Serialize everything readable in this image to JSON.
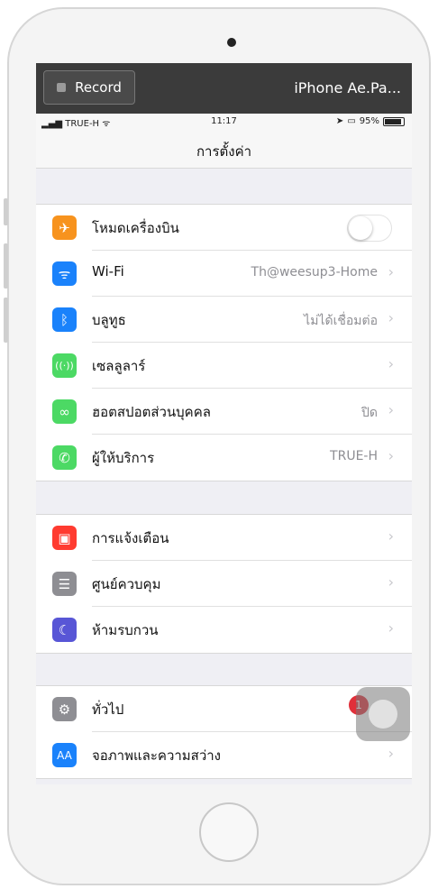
{
  "recorder": {
    "button_label": "Record",
    "device_title": "iPhone Ae.Pa..."
  },
  "status_bar": {
    "carrier": "TRUE-H",
    "time": "11:17",
    "battery": "95%"
  },
  "nav": {
    "title": "การตั้งค่า"
  },
  "colors": {
    "airplane": "#f7931e",
    "wifi": "#1a82fb",
    "bluetooth": "#1a82fb",
    "cellular": "#4cd964",
    "hotspot": "#4cd964",
    "carrier": "#4cd964",
    "notifications": "#ff3b30",
    "control_center": "#8e8e93",
    "dnd": "#5856d6",
    "general": "#8e8e93",
    "display": "#1a82fb",
    "badge": "#e0303a"
  },
  "group1": [
    {
      "label": "โหมดเครื่องบิน",
      "icon": "airplane-icon",
      "toggle": "off"
    },
    {
      "label": "Wi-Fi",
      "icon": "wifi-icon",
      "value": "Th@weesup3-Home"
    },
    {
      "label": "บลูทูธ",
      "icon": "bluetooth-icon",
      "value": "ไม่ได้เชื่อมต่อ"
    },
    {
      "label": "เซลลูลาร์",
      "icon": "cellular-icon",
      "value": ""
    },
    {
      "label": "ฮอตสปอตส่วนบุคคล",
      "icon": "hotspot-icon",
      "value": "ปิด"
    },
    {
      "label": "ผู้ให้บริการ",
      "icon": "carrier-phone-icon",
      "value": "TRUE-H"
    }
  ],
  "group2": [
    {
      "label": "การแจ้งเตือน",
      "icon": "notifications-icon"
    },
    {
      "label": "ศูนย์ควบคุม",
      "icon": "control-center-icon"
    },
    {
      "label": "ห้ามรบกวน",
      "icon": "moon-icon"
    }
  ],
  "group3": [
    {
      "label": "ทั่วไป",
      "icon": "gear-icon",
      "badge": "1"
    },
    {
      "label": "จอภาพและความสว่าง",
      "icon": "display-icon",
      "icon_text": "AA"
    }
  ]
}
